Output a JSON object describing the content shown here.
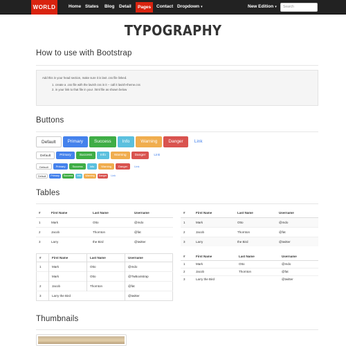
{
  "navbar": {
    "brand": "WORLD",
    "items": [
      "Home",
      "States",
      "Blog",
      "Detail",
      "Pages",
      "Contact",
      "Dropdown"
    ],
    "active": "Pages",
    "right_item": "New Edition",
    "search_placeholder": "Search"
  },
  "page_title": "TYPOGRAPHY",
  "sections": {
    "bootstrap": "How to use with Bootstrap",
    "buttons": "Buttons",
    "tables": "Tables",
    "thumbnails": "Thumbnails"
  },
  "well": {
    "intro": "Add this in your head section, make sure it is last .css file linked.",
    "steps": [
      "1. create a .css file with the lavish css in it -- call it lavish-theme.css",
      "2. in your link to that file in your .html file as shown below"
    ]
  },
  "buttons": [
    "Default",
    "Primary",
    "Success",
    "Info",
    "Warning",
    "Danger",
    "Link"
  ],
  "tables": {
    "headers": [
      "#",
      "First Name",
      "Last Name",
      "Username"
    ],
    "simple_rows": [
      [
        "1",
        "Mark",
        "Otto",
        "@mdo"
      ],
      [
        "2",
        "Jacob",
        "Thornton",
        "@fat"
      ],
      [
        "3",
        "Larry",
        "the Bird",
        "@twitter"
      ]
    ],
    "bordered_rows": [
      [
        "1",
        "Mark",
        "Otto",
        "@mdo"
      ],
      [
        "",
        "Mark",
        "Otto",
        "@TwBootstrap"
      ],
      [
        "2",
        "Jacob",
        "Thornton",
        "@fat"
      ],
      [
        "3",
        "Larry the Bird",
        "",
        "@twitter"
      ]
    ]
  }
}
